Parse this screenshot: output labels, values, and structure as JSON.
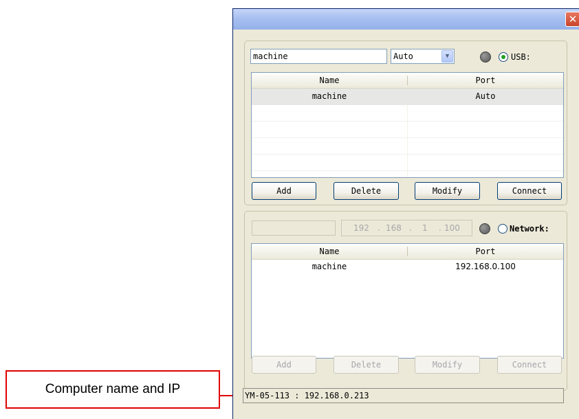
{
  "usb": {
    "name_value": "machine",
    "port_value": "Auto",
    "radio_label": "USB:",
    "radio_checked": true,
    "columns": [
      "Name",
      "Port"
    ],
    "rows": [
      {
        "name": "machine",
        "port": "Auto"
      }
    ],
    "buttons": {
      "add": "Add",
      "delete": "Delete",
      "modify": "Modify",
      "connect": "Connect"
    }
  },
  "network": {
    "name_value": "",
    "ip": [
      "192",
      "168",
      "1",
      "100"
    ],
    "radio_label": "Network:",
    "radio_checked": false,
    "columns": [
      "Name",
      "Port"
    ],
    "rows": [
      {
        "name": "machine",
        "port": "192.168.0.100"
      }
    ],
    "buttons": {
      "add": "Add",
      "delete": "Delete",
      "modify": "Modify",
      "connect": "Connect"
    }
  },
  "status_bar": "YM-05-113 : 192.168.0.213",
  "annotation": {
    "label": "Computer name and IP",
    "color": "#e00000"
  },
  "icons": {
    "close": "close-icon",
    "dropdown": "chevron-down-icon",
    "status_led": "status-led-icon"
  }
}
